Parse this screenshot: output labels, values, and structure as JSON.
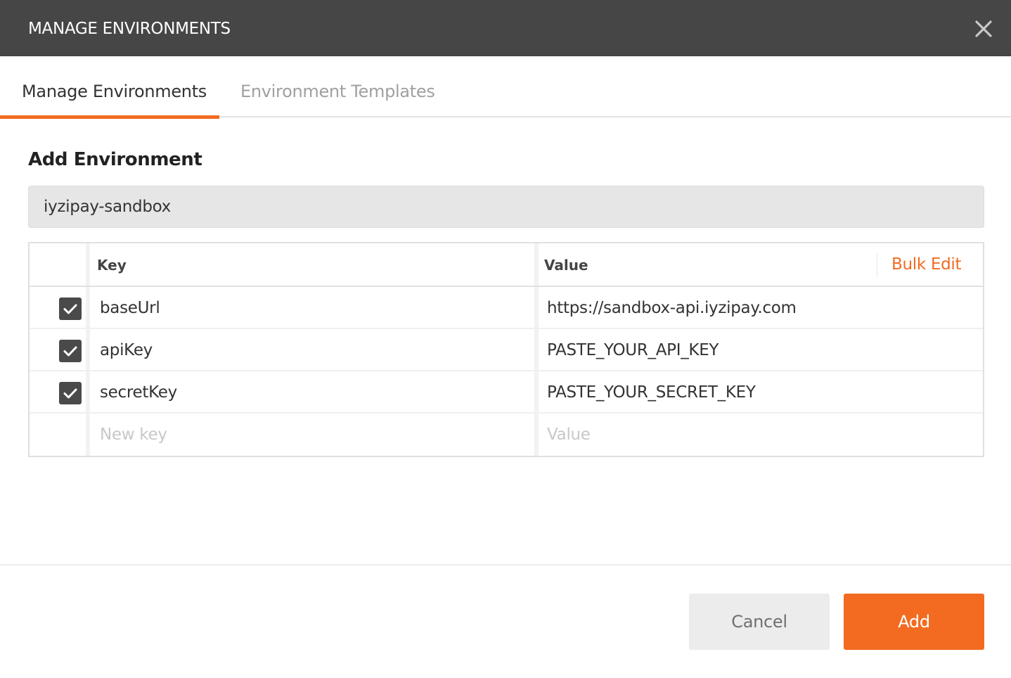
{
  "dialog": {
    "title": "MANAGE ENVIRONMENTS",
    "close_icon": "close-icon"
  },
  "tabs": [
    {
      "label": "Manage Environments",
      "active": true
    },
    {
      "label": "Environment Templates",
      "active": false
    }
  ],
  "form": {
    "heading": "Add Environment",
    "environment_name": "iyzipay-sandbox"
  },
  "table": {
    "headers": {
      "key": "Key",
      "value": "Value"
    },
    "bulk_edit_label": "Bulk Edit",
    "rows": [
      {
        "checked": true,
        "key": "baseUrl",
        "value": "https://sandbox-api.iyzipay.com"
      },
      {
        "checked": true,
        "key": "apiKey",
        "value": "PASTE_YOUR_API_KEY"
      },
      {
        "checked": true,
        "key": "secretKey",
        "value": "PASTE_YOUR_SECRET_KEY"
      }
    ],
    "new_row": {
      "key_placeholder": "New key",
      "value_placeholder": "Value"
    }
  },
  "buttons": {
    "cancel": "Cancel",
    "add": "Add"
  },
  "colors": {
    "titlebar": "#464646",
    "accent": "#f26b21",
    "checkbox": "#4a4a4a"
  }
}
